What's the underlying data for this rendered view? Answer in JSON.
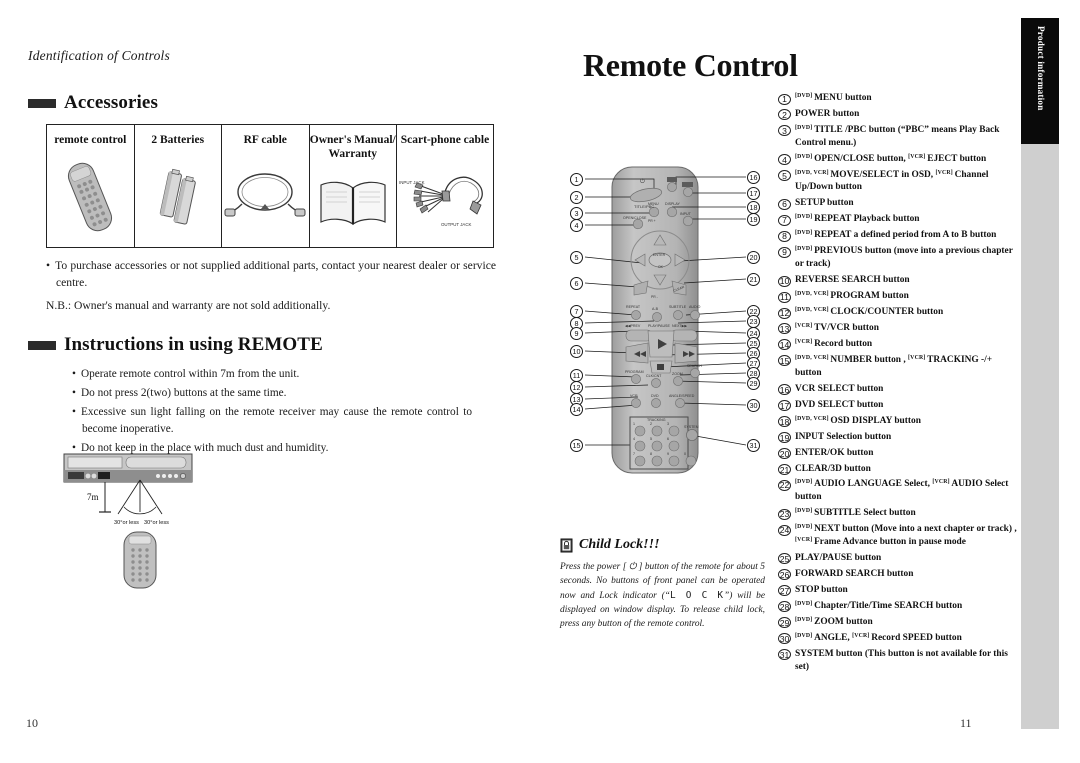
{
  "left_page": {
    "running_head": "Identification of Controls",
    "page_number": "10",
    "sections": [
      {
        "title": "Accessories"
      },
      {
        "title": "Instructions in using REMOTE"
      }
    ],
    "accessories_table": {
      "headers": [
        "remote control",
        "2 Batteries",
        "RF cable",
        "Owner's Manual/ Warranty",
        "Scart-phone cable"
      ],
      "scart_labels": {
        "input": "INPUT JACK",
        "output": "OUTPUT JACK"
      }
    },
    "notes": [
      "To purchase accessories or not supplied additional parts, contact your nearest dealer or service centre.",
      "N.B.: Owner's manual and warranty are not sold additionally."
    ],
    "instructions": [
      "Operate remote control within 7m from the unit.",
      "Do not press 2(two) buttons at the same time.",
      "Excessive sun light falling on the remote receiver may cause the remote control to become inoperative.",
      "Do not keep in the place with much dust and humidity."
    ],
    "range_figure": {
      "distance": "7m",
      "angle_left": "30°or less",
      "angle_right": "30°or less"
    }
  },
  "right_page": {
    "chapter_title": "Remote Control",
    "page_number": "11",
    "side_tab": "Product information",
    "child_lock": {
      "title": "Child Lock!!!",
      "body_before": "Press the power [ ⏻ ] button of the remote for about 5 seconds. No buttons of front panel can be operated now and Lock indicator (“",
      "lock_glyph": "L O C K",
      "body_after": "”) will be displayed on window display. To release child lock, press any button of the remote control."
    },
    "remote_diagram": {
      "left_callouts": [
        "1",
        "2",
        "3",
        "4",
        "5",
        "6",
        "7",
        "8",
        "9",
        "10",
        "11",
        "12",
        "13",
        "14",
        "15"
      ],
      "right_callouts": [
        "16",
        "17",
        "18",
        "19",
        "20",
        "21",
        "22",
        "23",
        "24",
        "25",
        "26",
        "27",
        "28",
        "29",
        "30",
        "31"
      ],
      "button_labels": [
        "TITLE/PBC",
        "MENU",
        "DISPLAY",
        "INPUT",
        "OPEN/CLOSE",
        "ENTER",
        "SETUP",
        "REPEAT",
        "A-B",
        "SUBTITLE",
        "AUDIO",
        "PREV",
        "PLAY/PAUSE",
        "NEXT",
        "PROGRAM",
        "CLK/CNT",
        "ZOOM",
        "SEARCH",
        "VCR",
        "DVD",
        "ANGLE/SPEED",
        "TRACKING",
        "SYSTEM",
        "PR +",
        "PR -"
      ],
      "keypad": [
        "1",
        "2",
        "3",
        "4",
        "5",
        "6",
        "7",
        "8",
        "9",
        "0"
      ]
    },
    "control_list": [
      {
        "num": "1",
        "tags": [
          "DVD"
        ],
        "text": "MENU button"
      },
      {
        "num": "2",
        "tags": [],
        "text": "POWER button"
      },
      {
        "num": "3",
        "tags": [
          "DVD"
        ],
        "text": "TITLE /PBC button (“PBC” means Play Back Control menu.)"
      },
      {
        "num": "4",
        "tags": [
          "DVD"
        ],
        "text": "OPEN/CLOSE button, ",
        "tag2": "VCR",
        "text2": "EJECT button"
      },
      {
        "num": "5",
        "tags": [
          "DVD, VCR"
        ],
        "text": "MOVE/SELECT in OSD, ",
        "tag2": "VCR",
        "text2": "Channel Up/Down button"
      },
      {
        "num": "6",
        "tags": [],
        "text": "SETUP button"
      },
      {
        "num": "7",
        "tags": [
          "DVD"
        ],
        "text": "REPEAT Playback button"
      },
      {
        "num": "8",
        "tags": [
          "DVD"
        ],
        "text": "REPEAT a defined period from A to B button"
      },
      {
        "num": "9",
        "tags": [
          "DVD"
        ],
        "text": "PREVIOUS button (move into a previous chapter or track)"
      },
      {
        "num": "10",
        "tags": [],
        "text": "REVERSE SEARCH button"
      },
      {
        "num": "11",
        "tags": [
          "DVD, VCR"
        ],
        "text": "PROGRAM button"
      },
      {
        "num": "12",
        "tags": [
          "DVD, VCR"
        ],
        "text": "CLOCK/COUNTER button"
      },
      {
        "num": "13",
        "tags": [
          "VCR"
        ],
        "text": "TV/VCR button"
      },
      {
        "num": "14",
        "tags": [
          "VCR"
        ],
        "text": "Record button"
      },
      {
        "num": "15",
        "tags": [
          "DVD, VCR"
        ],
        "text": "NUMBER button , ",
        "tag2": "VCR",
        "text2": "TRACKING -/+ button"
      },
      {
        "num": "16",
        "tags": [],
        "text": "VCR SELECT button"
      },
      {
        "num": "17",
        "tags": [],
        "text": "DVD SELECT button"
      },
      {
        "num": "18",
        "tags": [
          "DVD, VCR"
        ],
        "text": "OSD DISPLAY button"
      },
      {
        "num": "19",
        "tags": [],
        "text": "INPUT Selection button"
      },
      {
        "num": "20",
        "tags": [],
        "text": "ENTER/OK button"
      },
      {
        "num": "21",
        "tags": [],
        "text": "CLEAR/3D button"
      },
      {
        "num": "22",
        "tags": [
          "DVD"
        ],
        "text": "AUDIO LANGUAGE Select, ",
        "tag2": "VCR",
        "text2": "AUDIO Select button"
      },
      {
        "num": "23",
        "tags": [
          "DVD"
        ],
        "text": "SUBTITLE Select button"
      },
      {
        "num": "24",
        "tags": [
          "DVD"
        ],
        "text": "NEXT button (Move into a next chapter or track) , ",
        "tag2": "VCR",
        "text2": "Frame Advance button in pause mode"
      },
      {
        "num": "25",
        "tags": [],
        "text": "PLAY/PAUSE button"
      },
      {
        "num": "26",
        "tags": [],
        "text": "FORWARD SEARCH button"
      },
      {
        "num": "27",
        "tags": [],
        "text": "STOP button"
      },
      {
        "num": "28",
        "tags": [
          "DVD"
        ],
        "text": "Chapter/Title/Time SEARCH button"
      },
      {
        "num": "29",
        "tags": [
          "DVD"
        ],
        "text": "ZOOM button"
      },
      {
        "num": "30",
        "tags": [
          "DVD"
        ],
        "text": "ANGLE, ",
        "tag2": "VCR",
        "text2": "Record SPEED button"
      },
      {
        "num": "31",
        "tags": [],
        "text": "SYSTEM button (This button is not available for this set)"
      }
    ]
  },
  "colors": {
    "ink": "#111111",
    "rule": "#222222",
    "tab_bg": "#0a0a0a",
    "tab_bg_low": "#cfcfcf",
    "device_grey": "#a8a8a8"
  }
}
